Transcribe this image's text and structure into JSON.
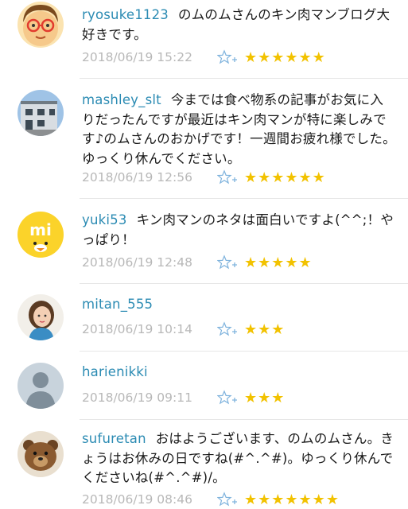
{
  "comments": [
    {
      "user": "ryosuke1123",
      "body": "のムのムさんのキン肉マンブログ大好きです。",
      "date": "2018/06/19 15:22",
      "stars": "★★★★★★",
      "avatar": "cartoon-face-avatar"
    },
    {
      "user": "mashley_slt",
      "body": "今までは食べ物系の記事がお気に入りだったんですが最近はキン肉マンが特に楽しみです♪のムさんのおかげです！一週間お疲れ様でした。ゆっくり休んでください。",
      "date": "2018/06/19 12:56",
      "stars": "★★★★★★",
      "avatar": "building-photo-avatar"
    },
    {
      "user": "yuki53",
      "body": "キン肉マンのネタは面白いですよ(^^;！やっぱり！",
      "date": "2018/06/19 12:48",
      "stars": "★★★★★",
      "avatar": "mi-bird-avatar"
    },
    {
      "user": "mitan_555",
      "body": "",
      "date": "2018/06/19 10:14",
      "stars": "★★★",
      "avatar": "woman-photo-avatar"
    },
    {
      "user": "harienikki",
      "body": "",
      "date": "2018/06/19 09:11",
      "stars": "★★★",
      "avatar": "default-user-avatar"
    },
    {
      "user": "sufuretan",
      "body": "おはようございます、のムのムさん。きょうはお休みの日ですね(#^.^#)。ゆっくり休んでくださいね(#^.^#)/。",
      "date": "2018/06/19 08:46",
      "stars": "★★★★★★★",
      "avatar": "teddy-bear-avatar"
    }
  ],
  "colors": {
    "username": "#2b8bb3",
    "star": "#f2c200",
    "date": "#b8b8b8",
    "divider": "#e6e6e6"
  }
}
